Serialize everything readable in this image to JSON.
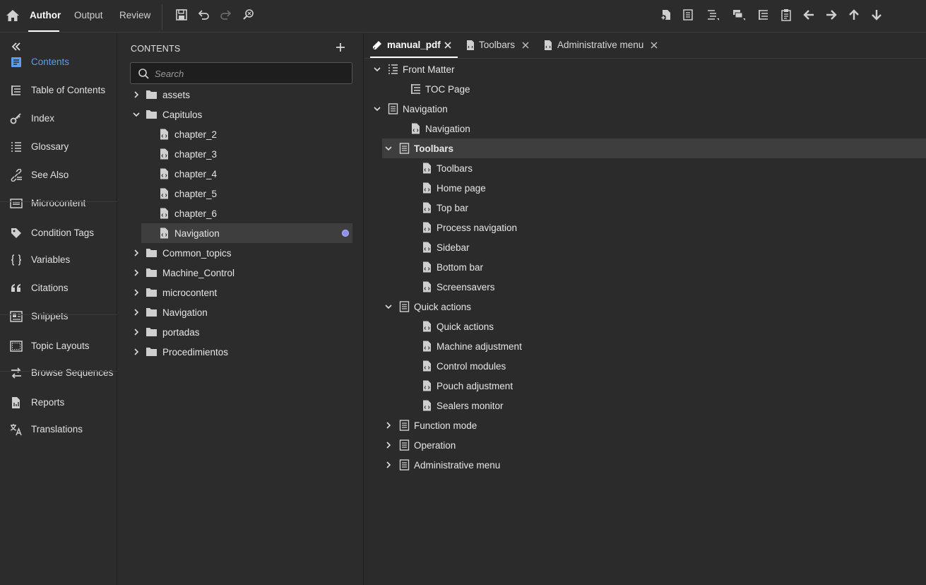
{
  "topbar": {
    "nav": [
      "Author",
      "Output",
      "Review"
    ],
    "active": "Author"
  },
  "rail": {
    "items": [
      {
        "label": "Contents",
        "icon": "contents-icon",
        "active": true
      },
      {
        "label": "Table of Contents",
        "icon": "toc-icon"
      },
      {
        "label": "Index",
        "icon": "key-icon"
      },
      {
        "label": "Glossary",
        "icon": "glossary-icon"
      },
      {
        "label": "See Also",
        "icon": "see-also-icon"
      },
      {
        "label": "Microcontent",
        "icon": "microcontent-icon"
      },
      {
        "label": "Condition Tags",
        "icon": "tag-icon"
      },
      {
        "label": "Variables",
        "icon": "braces-icon"
      },
      {
        "label": "Citations",
        "icon": "quote-icon"
      },
      {
        "label": "Snippets",
        "icon": "snippet-icon"
      },
      {
        "label": "Topic Layouts",
        "icon": "layout-icon"
      },
      {
        "label": "Browse Sequences",
        "icon": "sequence-icon"
      },
      {
        "label": "Reports",
        "icon": "report-icon"
      },
      {
        "label": "Translations",
        "icon": "translate-icon"
      }
    ]
  },
  "contents": {
    "title": "CONTENTS",
    "search_placeholder": "Search",
    "tree": [
      {
        "label": "assets",
        "type": "folder",
        "expanded": false,
        "level": 0
      },
      {
        "label": "Capitulos",
        "type": "folder",
        "expanded": true,
        "level": 0
      },
      {
        "label": "chapter_2",
        "type": "file",
        "level": 1
      },
      {
        "label": "chapter_3",
        "type": "file",
        "level": 1
      },
      {
        "label": "chapter_4",
        "type": "file",
        "level": 1
      },
      {
        "label": "chapter_5",
        "type": "file",
        "level": 1
      },
      {
        "label": "chapter_6",
        "type": "file",
        "level": 1
      },
      {
        "label": "Navigation",
        "type": "file",
        "level": 1,
        "selected": true
      },
      {
        "label": "Common_topics",
        "type": "folder",
        "expanded": false,
        "level": 0
      },
      {
        "label": "Machine_Control",
        "type": "folder",
        "expanded": false,
        "level": 0
      },
      {
        "label": "microcontent",
        "type": "folder",
        "expanded": false,
        "level": 0
      },
      {
        "label": "Navigation",
        "type": "folder",
        "expanded": false,
        "level": 0
      },
      {
        "label": "portadas",
        "type": "folder",
        "expanded": false,
        "level": 0
      },
      {
        "label": "Procedimientos",
        "type": "folder",
        "expanded": false,
        "level": 0
      }
    ]
  },
  "editor": {
    "tabs": [
      {
        "label": "manual_pdf",
        "active": true,
        "icon": "pdf-edit-icon"
      },
      {
        "label": "Toolbars",
        "active": false,
        "icon": "file-icon"
      },
      {
        "label": "Administrative menu",
        "active": false,
        "icon": "file-icon"
      }
    ],
    "tree": [
      {
        "label": "Front Matter",
        "kind": "toc-list",
        "level": 0,
        "chevron": "down"
      },
      {
        "label": "TOC Page",
        "kind": "toc",
        "level": 1,
        "chevron": "none"
      },
      {
        "label": "Navigation",
        "kind": "doc",
        "level": 0,
        "chevron": "down"
      },
      {
        "label": "Navigation",
        "kind": "file",
        "level": 1,
        "chevron": "none"
      },
      {
        "label": "Toolbars",
        "kind": "doc",
        "level": 1,
        "chevron": "down",
        "selected": true
      },
      {
        "label": "Toolbars",
        "kind": "file",
        "level": 2,
        "chevron": "none"
      },
      {
        "label": "Home page",
        "kind": "file",
        "level": 2,
        "chevron": "none"
      },
      {
        "label": "Top bar",
        "kind": "file",
        "level": 2,
        "chevron": "none"
      },
      {
        "label": "Process navigation",
        "kind": "file",
        "level": 2,
        "chevron": "none"
      },
      {
        "label": "Sidebar",
        "kind": "file",
        "level": 2,
        "chevron": "none"
      },
      {
        "label": "Bottom bar",
        "kind": "file",
        "level": 2,
        "chevron": "none"
      },
      {
        "label": "Screensavers",
        "kind": "file",
        "level": 2,
        "chevron": "none"
      },
      {
        "label": "Quick actions",
        "kind": "doc",
        "level": 1,
        "chevron": "down"
      },
      {
        "label": "Quick actions",
        "kind": "file",
        "level": 2,
        "chevron": "none"
      },
      {
        "label": "Machine adjustment",
        "kind": "file",
        "level": 2,
        "chevron": "none"
      },
      {
        "label": "Control modules",
        "kind": "file",
        "level": 2,
        "chevron": "none"
      },
      {
        "label": "Pouch adjustment",
        "kind": "file",
        "level": 2,
        "chevron": "none"
      },
      {
        "label": "Sealers monitor",
        "kind": "file",
        "level": 2,
        "chevron": "none"
      },
      {
        "label": "Function mode",
        "kind": "doc",
        "level": 1,
        "chevron": "right"
      },
      {
        "label": "Operation",
        "kind": "doc",
        "level": 1,
        "chevron": "right"
      },
      {
        "label": "Administrative menu",
        "kind": "doc",
        "level": 1,
        "chevron": "right"
      }
    ]
  },
  "colors": {
    "accent": "#5c9ded",
    "background": "#2c2c2c",
    "selected_row": "#3e3e3e",
    "dot": "#8c8ef0"
  }
}
